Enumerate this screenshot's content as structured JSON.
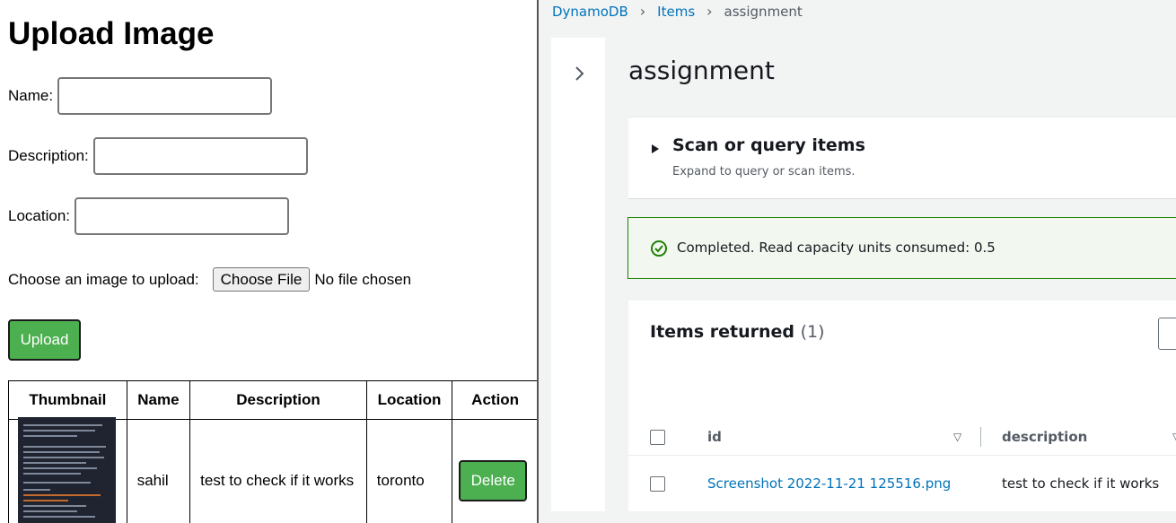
{
  "upload_page": {
    "title": "Upload Image",
    "form": {
      "name_label": "Name:",
      "name_value": "",
      "description_label": "Description:",
      "description_value": "",
      "location_label": "Location:",
      "location_value": "",
      "file_label": "Choose an image to upload:",
      "choose_file_button": "Choose File",
      "no_file_text": "No file chosen",
      "upload_button": "Upload"
    },
    "table": {
      "headers": [
        "Thumbnail",
        "Name",
        "Description",
        "Location",
        "Action"
      ],
      "rows": [
        {
          "name": "sahil",
          "description": "test to check if it works",
          "location": "toronto",
          "action": "Delete"
        }
      ]
    }
  },
  "dynamodb": {
    "breadcrumb": [
      "DynamoDB",
      "Items",
      "assignment"
    ],
    "title": "assignment",
    "scan_panel": {
      "title": "Scan or query items",
      "subtitle": "Expand to query or scan items."
    },
    "status": {
      "text": "Completed. Read capacity units consumed: 0.5",
      "color": "#1d8102"
    },
    "items": {
      "title": "Items returned",
      "count": "(1)",
      "columns": [
        "id",
        "description"
      ],
      "rows": [
        {
          "id": "Screenshot 2022-11-21 125516.png",
          "description": "test to check if it works"
        }
      ]
    }
  },
  "colors": {
    "upload_green": "#4caf50",
    "aws_link": "#0073bb",
    "aws_success": "#1d8102"
  }
}
